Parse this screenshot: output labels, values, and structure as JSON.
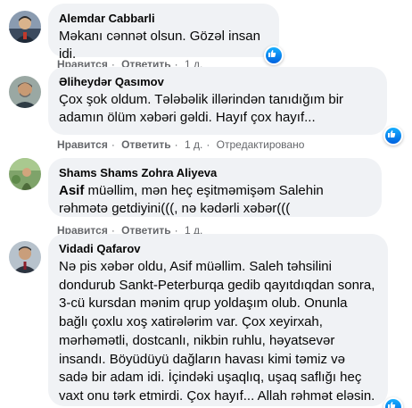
{
  "comments": [
    {
      "author": "Alemdar Cabbarli",
      "text": "Məkanı cənnət olsun. Gözəl insan idi.",
      "like_label": "Нравится",
      "reply_label": "Ответить",
      "time": "1 д.",
      "edited": ""
    },
    {
      "author": "Əliheydər Qasımov",
      "text": "Çox şok oldum. Tələbəlik illərindən tanıdığım bir adamın ölüm xəbəri gəldi. Hayıf çox hayıf...",
      "like_label": "Нравится",
      "reply_label": "Ответить",
      "time": "1 д.",
      "edited": "Отредактировано"
    },
    {
      "author": "Shams Shams Zohra Aliyeva",
      "mention": "Asif",
      "text": " müəllim, mən heç eşitməmişəm Salehin rəhmətə getdiyini(((, nə kədərli xəbər(((",
      "like_label": "Нравится",
      "reply_label": "Ответить",
      "time": "1 д.",
      "edited": ""
    },
    {
      "author": "Vidadi Qafarov",
      "text": "Nə pis xəbər oldu, Asif müəllim. Saleh təhsilini dondurub Sankt-Peterburqa gedib qayıtdıqdan sonra, 3-cü kursdan mənim qrup yoldaşım olub. Onunla bağlı çoxlu xoş xatirələrim var. Çox xeyirxah, mərhəmətli, dostcanlı, nikbin ruhlu, həyatsevər insandı. Böyüdüyü dağların havası kimi təmiz və sadə bir adam idi. İçindəki uşaqlıq, uşaq saflığı heç vaxt onu tərk etmirdi. Çox hayıf... Allah rəhmət eləsin. məkanı cənnət olsun."
    }
  ],
  "icons": {
    "like_reaction": "thumbs-up-icon",
    "reaction_color": "#1877f2"
  }
}
